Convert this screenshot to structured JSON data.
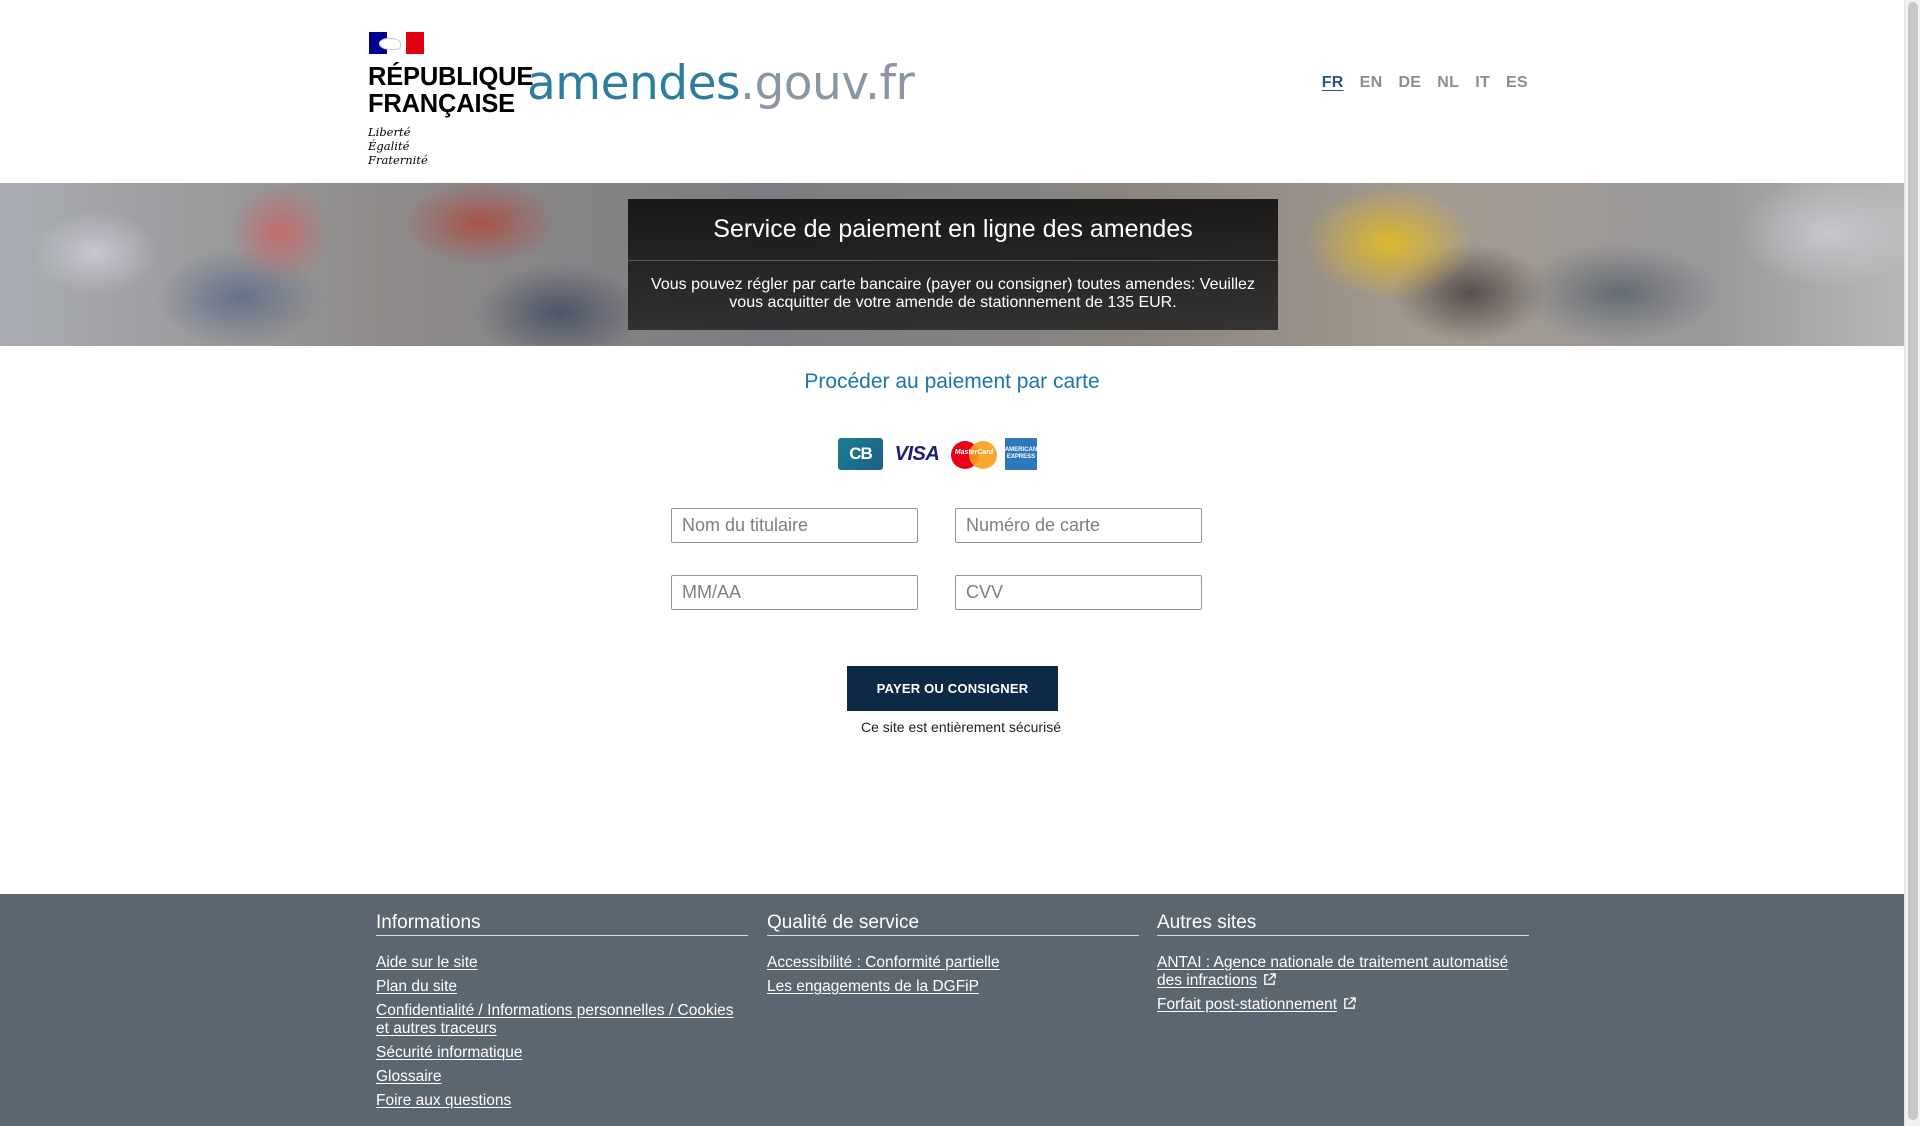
{
  "header": {
    "logo": {
      "name_line1": "RÉPUBLIQUE",
      "name_line2": "FRANÇAISE",
      "motto_line1": "Liberté",
      "motto_line2": "Égalité",
      "motto_line3": "Fraternité"
    },
    "site_name_part1": "amendes",
    "site_name_part2": ".gouv.fr",
    "languages": [
      "FR",
      "EN",
      "DE",
      "NL",
      "IT",
      "ES"
    ],
    "active_language": "FR"
  },
  "banner": {
    "title": "Service de paiement en ligne des amendes",
    "text": "Vous pouvez régler par carte bancaire (payer ou consigner) toutes amendes: Veuillez vous acquitter de votre amende de stationnement de 135 EUR."
  },
  "payment": {
    "title": "Procéder au paiement par carte",
    "cards": {
      "cb": "CB",
      "visa": "VISA",
      "mastercard": "MasterCard",
      "amex": "AMERICAN EXPRESS"
    },
    "fields": {
      "holder_placeholder": "Nom du titulaire",
      "card_number_placeholder": "Numéro de carte",
      "expiry_placeholder": "MM/AA",
      "cvv_placeholder": "CVV"
    },
    "submit_label": "PAYER OU CONSIGNER",
    "secure_note": "Ce site est entièrement sécurisé"
  },
  "footer": {
    "informations": {
      "title": "Informations",
      "links": [
        "Aide sur le site",
        "Plan du site",
        "Confidentialité / Informations personnelles / Cookies et autres traceurs",
        "Sécurité informatique",
        "Glossaire",
        "Foire aux questions"
      ]
    },
    "qualite": {
      "title": "Qualité de service",
      "links": [
        "Accessibilité : Conformité partielle",
        "Les engagements de la DGFiP"
      ]
    },
    "autres": {
      "title": "Autres sites",
      "links": [
        "ANTAI : Agence nationale de traitement automatisé des infractions",
        "Forfait post-stationnement"
      ]
    }
  },
  "colors": {
    "brand_blue": "#000091",
    "brand_red": "#e1000f",
    "title_blue": "#1a74b0",
    "button_navy": "#0c2a45",
    "footer_bg": "#5a6670"
  }
}
